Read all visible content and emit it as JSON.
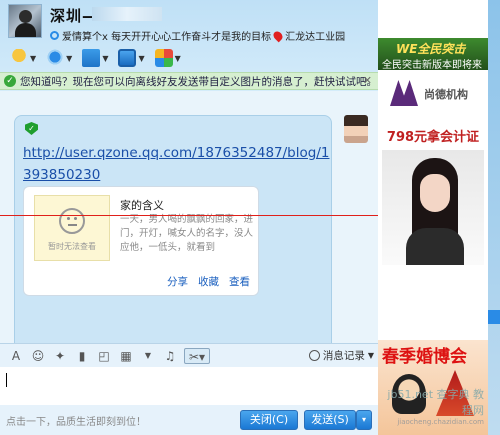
{
  "header": {
    "nickname": "深圳",
    "nick_dash": "——",
    "signature_icon": "qzone-icon",
    "signature_text": "爱情算个x 每天开开心心工作奋斗才是我的目标",
    "location_icon": "location-pin-icon",
    "location_text": "汇龙达工业园"
  },
  "window_buttons": [
    "▢",
    "—",
    "✕"
  ],
  "toolbar": {
    "items": [
      "microphone-icon",
      "video-camera-icon",
      "file-transfer-icon",
      "remote-desktop-icon",
      "apps-icon"
    ]
  },
  "notice": {
    "text": "您知道吗？现在您可以向离线好友发送带自定义图片的消息了，赶快试试吧。",
    "close": "✕"
  },
  "message": {
    "link": "http://user.qzone.qq.com/1876352487/blog/1393850230",
    "card": {
      "image_caption": "暂时无法查看",
      "title": "家的含义",
      "desc": "一天，男人喝的飘飘的回家，进门，开灯，喊女人的名字，没人应他，一低头，就看到",
      "actions": [
        "分享",
        "收藏",
        "查看"
      ]
    }
  },
  "edit_toolbar": {
    "font": "A",
    "emoji": "☺",
    "history_label": "消息记录"
  },
  "input": {
    "value": ""
  },
  "bottom": {
    "status": "点击一下，品质生活即刻到位！",
    "close_label": "关闭(C)",
    "send_label": "发送(S)",
    "send_arrow": "▾"
  },
  "ads": {
    "game_title": "WE全民突击",
    "game_sub": "全民突击新版本即将来",
    "logo_text": "尚德机构",
    "price": "798元拿会计证",
    "wedding_title": "春季婚博会",
    "watermark": "jb51.net 查字典 教程网",
    "watermark_small": "jiaocheng.chazidian.com"
  },
  "colors": {
    "accent": "#1a78d4",
    "link": "#1a4fa8",
    "notice_bg": "#d6efd0",
    "redline": "#e0201a"
  }
}
